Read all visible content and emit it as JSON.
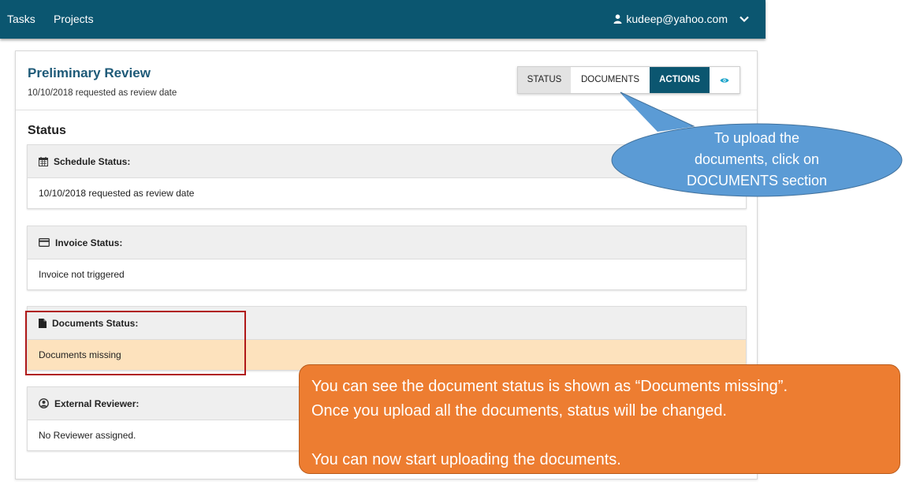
{
  "nav": {
    "links": [
      "Tasks",
      "Projects"
    ],
    "user_email": "kudeep@yahoo.com",
    "user_icon": "user-icon",
    "dropdown_icon": "chevron-down-icon"
  },
  "review": {
    "title": "Preliminary Review",
    "subtitle": "10/10/2018 requested as review date",
    "tabs": [
      "STATUS",
      "DOCUMENTS",
      "ACTIONS"
    ],
    "view_icon": "eye-icon"
  },
  "status": {
    "heading": "Status",
    "panels": [
      {
        "icon": "calendar-icon",
        "label": "Schedule Status:",
        "value": "10/10/2018 requested as review date"
      },
      {
        "icon": "credit-card-icon",
        "label": "Invoice Status:",
        "value": "Invoice not triggered"
      },
      {
        "icon": "file-icon",
        "label": "Documents Status:",
        "value": "Documents missing"
      },
      {
        "icon": "user-circle-icon",
        "label": "External Reviewer:",
        "value": "No Reviewer assigned."
      }
    ]
  },
  "annotations": {
    "blue_callout": [
      "To upload the",
      "documents, click on",
      "DOCUMENTS section"
    ],
    "orange_callout": {
      "line1": "You can see the document status is shown as “Documents missing”.",
      "line2": "Once you upload all the documents, status will be changed.",
      "line3": "You can now start uploading the documents."
    }
  },
  "colors": {
    "navbar": "#0b5670",
    "title": "#1e5a78",
    "warning_bg": "#fde2bd",
    "blue_callout": "#5b9bd5",
    "orange_callout": "#ed7d31",
    "highlight_border": "#b01818"
  }
}
